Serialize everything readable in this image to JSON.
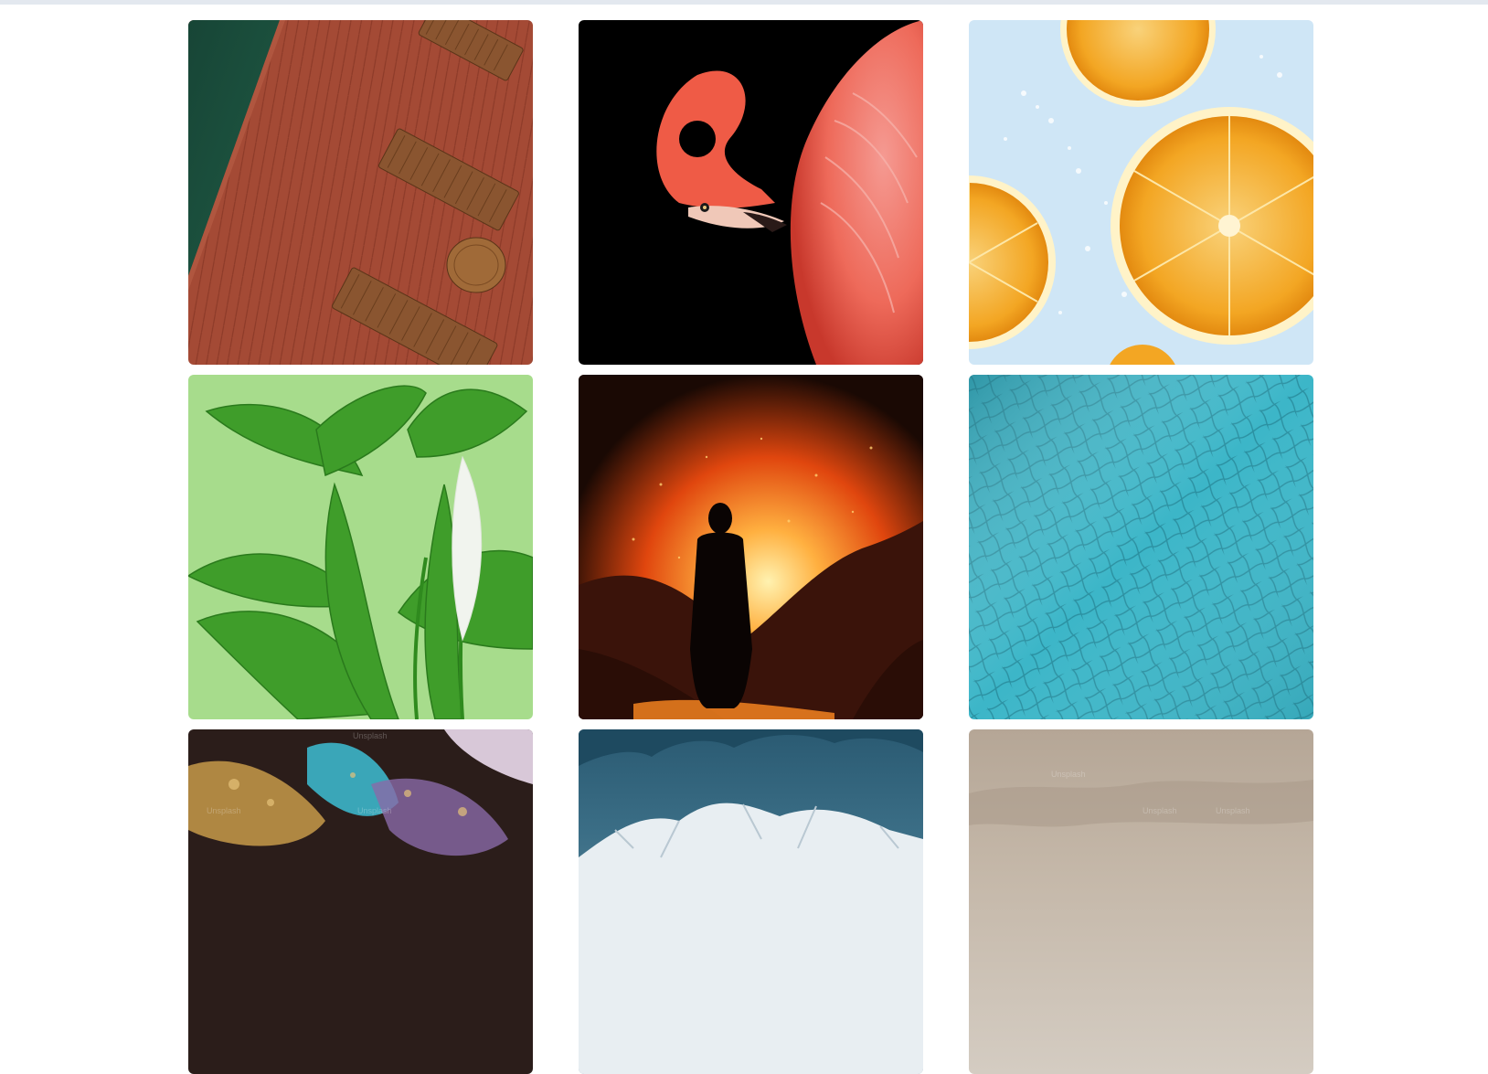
{
  "gallery": {
    "tiles": [
      {
        "subject": "pool-deck-loungers",
        "colors": {
          "water": "#1a4a36",
          "deck": "#a44a35",
          "wood": "#8a5530"
        }
      },
      {
        "subject": "flamingo",
        "colors": {
          "bg": "#000000",
          "bird": "#ec5a45",
          "feathers": "#f08b85"
        }
      },
      {
        "subject": "orange-slices",
        "colors": {
          "bg": "#cfe6f6",
          "rind": "#f0a21a",
          "pulp": "#f6b53a"
        }
      },
      {
        "subject": "peace-lily-plant",
        "colors": {
          "bg": "#a7dc8c",
          "leaf": "#3c9a28",
          "flower": "#f1f4ee"
        }
      },
      {
        "subject": "volcano-silhouette",
        "colors": {
          "sky": "#1a0904",
          "fire": "#ff7a1a",
          "rock": "#3a130a"
        }
      },
      {
        "subject": "pool-tiles",
        "colors": {
          "water": "#3cb6c8",
          "line": "#2a8fa0"
        }
      },
      {
        "subject": "fluid-art",
        "colors": {
          "dark": "#2b1d1a",
          "teal": "#3aa6b8",
          "gold": "#c79a4a"
        }
      },
      {
        "subject": "snowy-mountain",
        "colors": {
          "sky": "#2a5a72",
          "snow": "#e8eef2"
        }
      },
      {
        "subject": "cloudy-sky",
        "colors": {
          "sky": "#b5a696"
        }
      }
    ],
    "watermarks": [
      "Unsplash",
      "Unsplash",
      "Unsplash",
      "Unsplash",
      "Unsplash",
      "Unsplash"
    ]
  }
}
